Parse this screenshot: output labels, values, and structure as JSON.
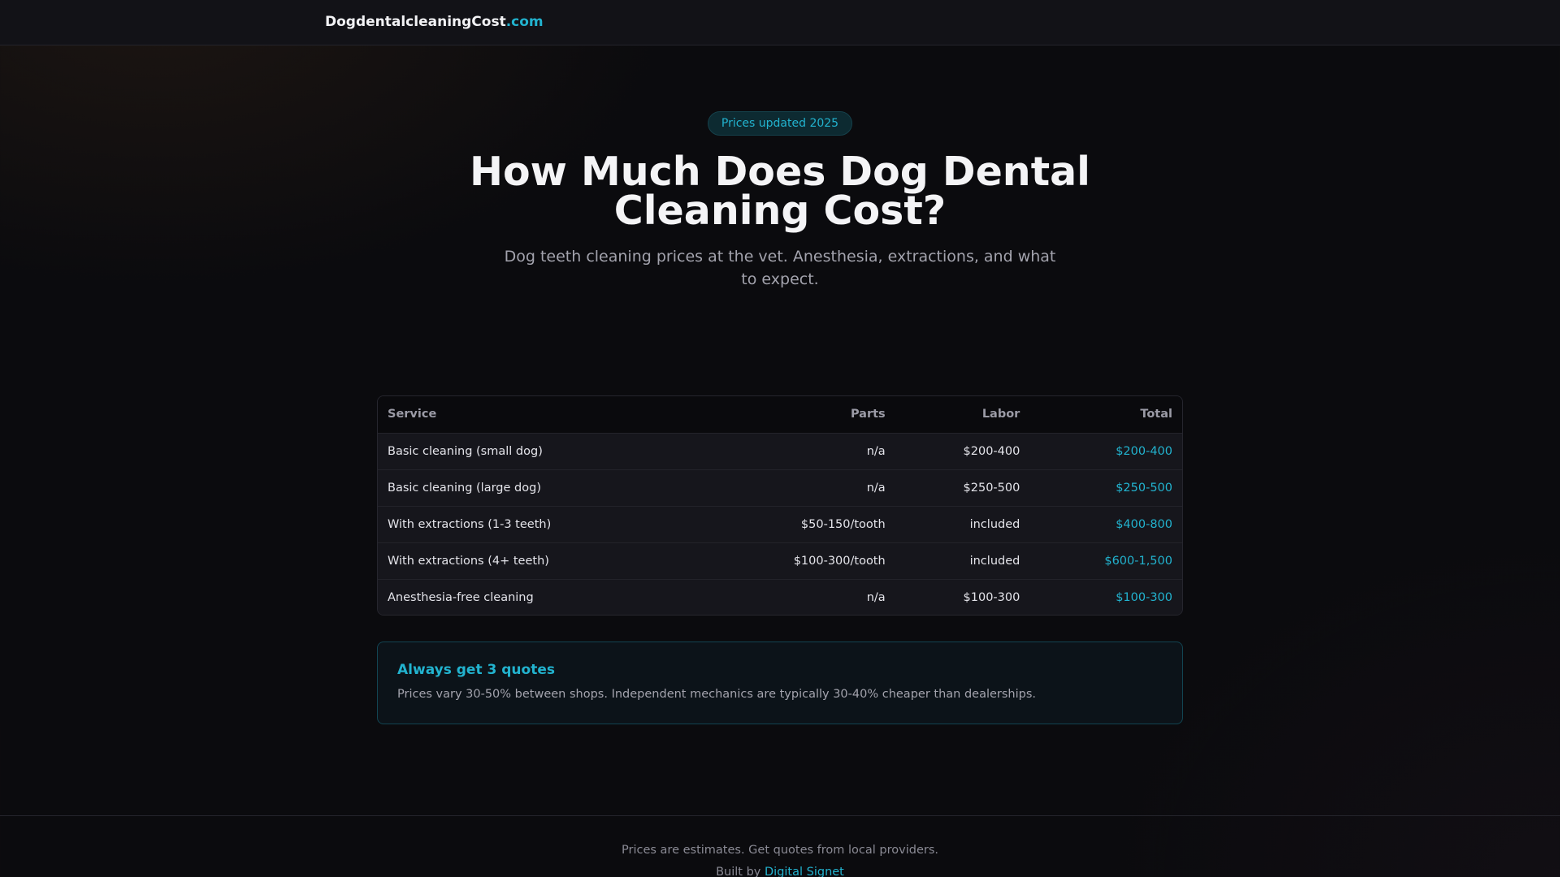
{
  "header": {
    "brand_name": "DogdentalcleaningCost",
    "brand_tld": ".com"
  },
  "hero": {
    "badge": "Prices updated 2025",
    "title": "How Much Does Dog Dental Cleaning Cost?",
    "subtitle": "Dog teeth cleaning prices at the vet. Anesthesia, extractions, and what to expect."
  },
  "table": {
    "columns": [
      "Service",
      "Parts",
      "Labor",
      "Total"
    ],
    "rows": [
      {
        "service": "Basic cleaning (small dog)",
        "parts": "n/a",
        "labor": "$200-400",
        "total": "$200-400"
      },
      {
        "service": "Basic cleaning (large dog)",
        "parts": "n/a",
        "labor": "$250-500",
        "total": "$250-500"
      },
      {
        "service": "With extractions (1-3 teeth)",
        "parts": "$50-150/tooth",
        "labor": "included",
        "total": "$400-800"
      },
      {
        "service": "With extractions (4+ teeth)",
        "parts": "$100-300/tooth",
        "labor": "included",
        "total": "$600-1,500"
      },
      {
        "service": "Anesthesia-free cleaning",
        "parts": "n/a",
        "labor": "$100-300",
        "total": "$100-300"
      }
    ]
  },
  "callout": {
    "title": "Always get 3 quotes",
    "text": "Prices vary 30-50% between shops. Independent mechanics are typically 30-40% cheaper than dealerships."
  },
  "footer": {
    "note": "Prices are estimates. Get quotes from local providers.",
    "built_prefix": "Built by ",
    "built_link": "Digital Signet"
  },
  "colors": {
    "accent": "#22b3cf",
    "background": "#0b0b0e",
    "header_bg": "#121217"
  }
}
